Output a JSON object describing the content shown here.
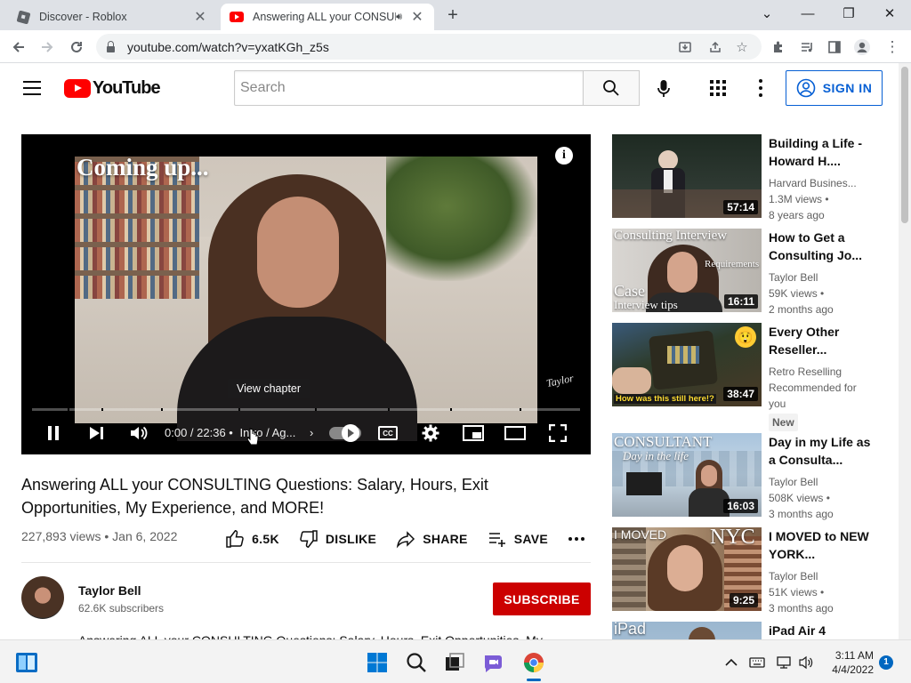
{
  "browser": {
    "tabs": [
      {
        "title": "Discover - Roblox",
        "active": false
      },
      {
        "title": "Answering ALL your CONSULTING",
        "active": true
      }
    ],
    "url": "youtube.com/watch?v=yxatKGh_z5s"
  },
  "header": {
    "logo_text": "YouTube",
    "search_placeholder": "Search",
    "signin_label": "SIGN IN"
  },
  "player": {
    "overlay_text": "Coming up...",
    "signature": "Taylor",
    "chapter_tooltip": "View chapter",
    "time": "0:00 / 22:36",
    "chapter_label": "Intro / Ag...",
    "progress_fraction": 0
  },
  "video": {
    "title": "Answering ALL your CONSULTING Questions: Salary, Hours, Exit Opportunities, My Experience, and MORE!",
    "views_date": "227,893 views • Jan 6, 2022",
    "like_count": "6.5K",
    "dislike_label": "DISLIKE",
    "share_label": "SHARE",
    "save_label": "SAVE",
    "description_preview": "Answering ALL your CONSULTING Questions: Salary, Hours, Exit Opportunities, My"
  },
  "channel": {
    "name": "Taylor Bell",
    "subscribers": "62.6K subscribers",
    "subscribe_label": "SUBSCRIBE"
  },
  "recommendations": [
    {
      "title": "Building a Life - Howard H....",
      "channel": "Harvard Busines...",
      "views": "1.3M views •",
      "age": "8 years ago",
      "duration": "57:14"
    },
    {
      "title": "How to Get a Consulting Jo...",
      "channel": "Taylor Bell",
      "views": "59K views •",
      "age": "2 months ago",
      "duration": "16:11",
      "thumb_texts": [
        "Consulting Interview",
        "Requirements",
        "Case",
        "Interview tips"
      ]
    },
    {
      "title": "Every Other Reseller...",
      "channel": "Retro Reselling",
      "views": "Recommended for you",
      "age": "",
      "badge": "New",
      "duration": "38:47",
      "thumb_texts": [
        "How was this still here!?"
      ]
    },
    {
      "title": "Day in my Life as a Consulta...",
      "channel": "Taylor Bell",
      "views": "508K views •",
      "age": "3 months ago",
      "duration": "16:03",
      "thumb_texts": [
        "CONSULTANT",
        "Day in the life"
      ]
    },
    {
      "title": "I MOVED to NEW YORK...",
      "channel": "Taylor Bell",
      "views": "51K views •",
      "age": "3 months ago",
      "duration": "9:25",
      "thumb_texts": [
        "I MOVED",
        "NYC"
      ]
    },
    {
      "title": "iPad Air 4",
      "channel": "",
      "views": "",
      "age": "",
      "duration": "",
      "thumb_texts": [
        "iPad"
      ]
    }
  ],
  "taskbar": {
    "time": "3:11 AM",
    "date": "4/4/2022",
    "notification_count": "1"
  },
  "colors": {
    "brand_red": "#ff0000",
    "subscribe_red": "#cc0000",
    "link_blue": "#065fd4"
  }
}
